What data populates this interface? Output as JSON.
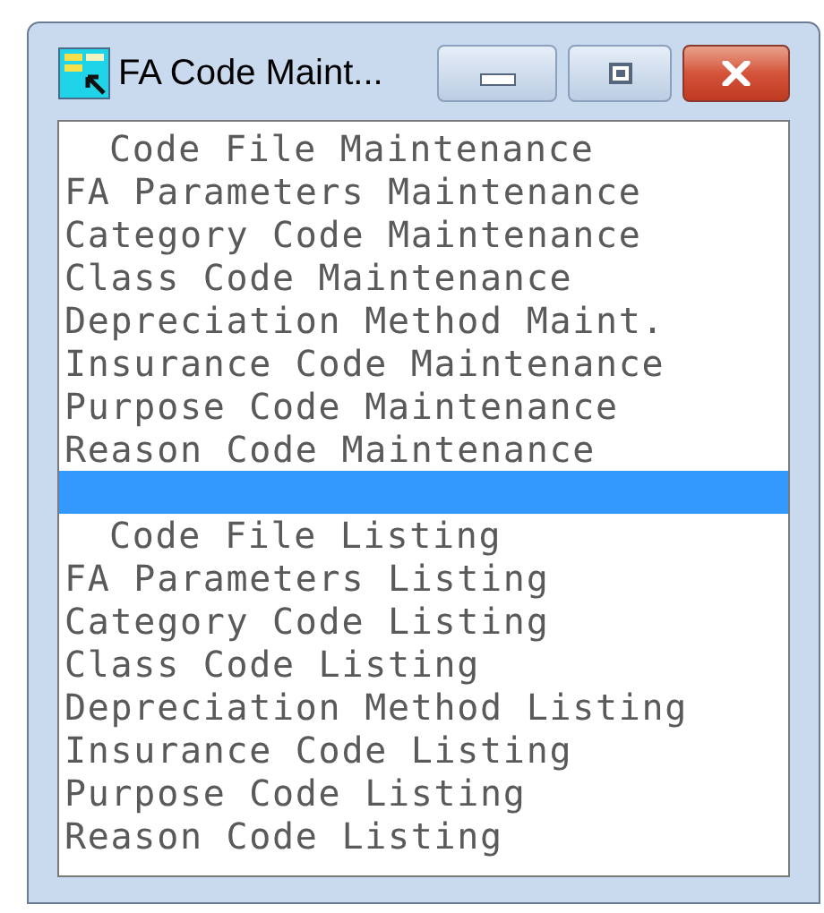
{
  "window": {
    "title": "FA Code Maint..."
  },
  "list": {
    "items": [
      {
        "kind": "heading",
        "label": "Code File Maintenance",
        "selected": false
      },
      {
        "kind": "entry",
        "label": "FA Parameters Maintenance",
        "selected": false
      },
      {
        "kind": "entry",
        "label": "Category Code Maintenance",
        "selected": false
      },
      {
        "kind": "entry",
        "label": "Class Code Maintenance",
        "selected": false
      },
      {
        "kind": "entry",
        "label": "Depreciation Method Maint.",
        "selected": false
      },
      {
        "kind": "entry",
        "label": "Insurance Code Maintenance",
        "selected": false
      },
      {
        "kind": "entry",
        "label": "Purpose Code Maintenance",
        "selected": false
      },
      {
        "kind": "entry",
        "label": "Reason Code Maintenance",
        "selected": false
      },
      {
        "kind": "blank",
        "selected": true
      },
      {
        "kind": "heading",
        "label": "Code File Listing",
        "selected": false
      },
      {
        "kind": "entry",
        "label": "FA Parameters Listing",
        "selected": false
      },
      {
        "kind": "entry",
        "label": "Category Code Listing",
        "selected": false
      },
      {
        "kind": "entry",
        "label": "Class Code Listing",
        "selected": false
      },
      {
        "kind": "entry",
        "label": "Depreciation Method Listing",
        "selected": false
      },
      {
        "kind": "entry",
        "label": "Insurance Code Listing",
        "selected": false
      },
      {
        "kind": "entry",
        "label": "Purpose Code Listing",
        "selected": false
      },
      {
        "kind": "entry",
        "label": "Reason Code Listing",
        "selected": false
      }
    ]
  }
}
